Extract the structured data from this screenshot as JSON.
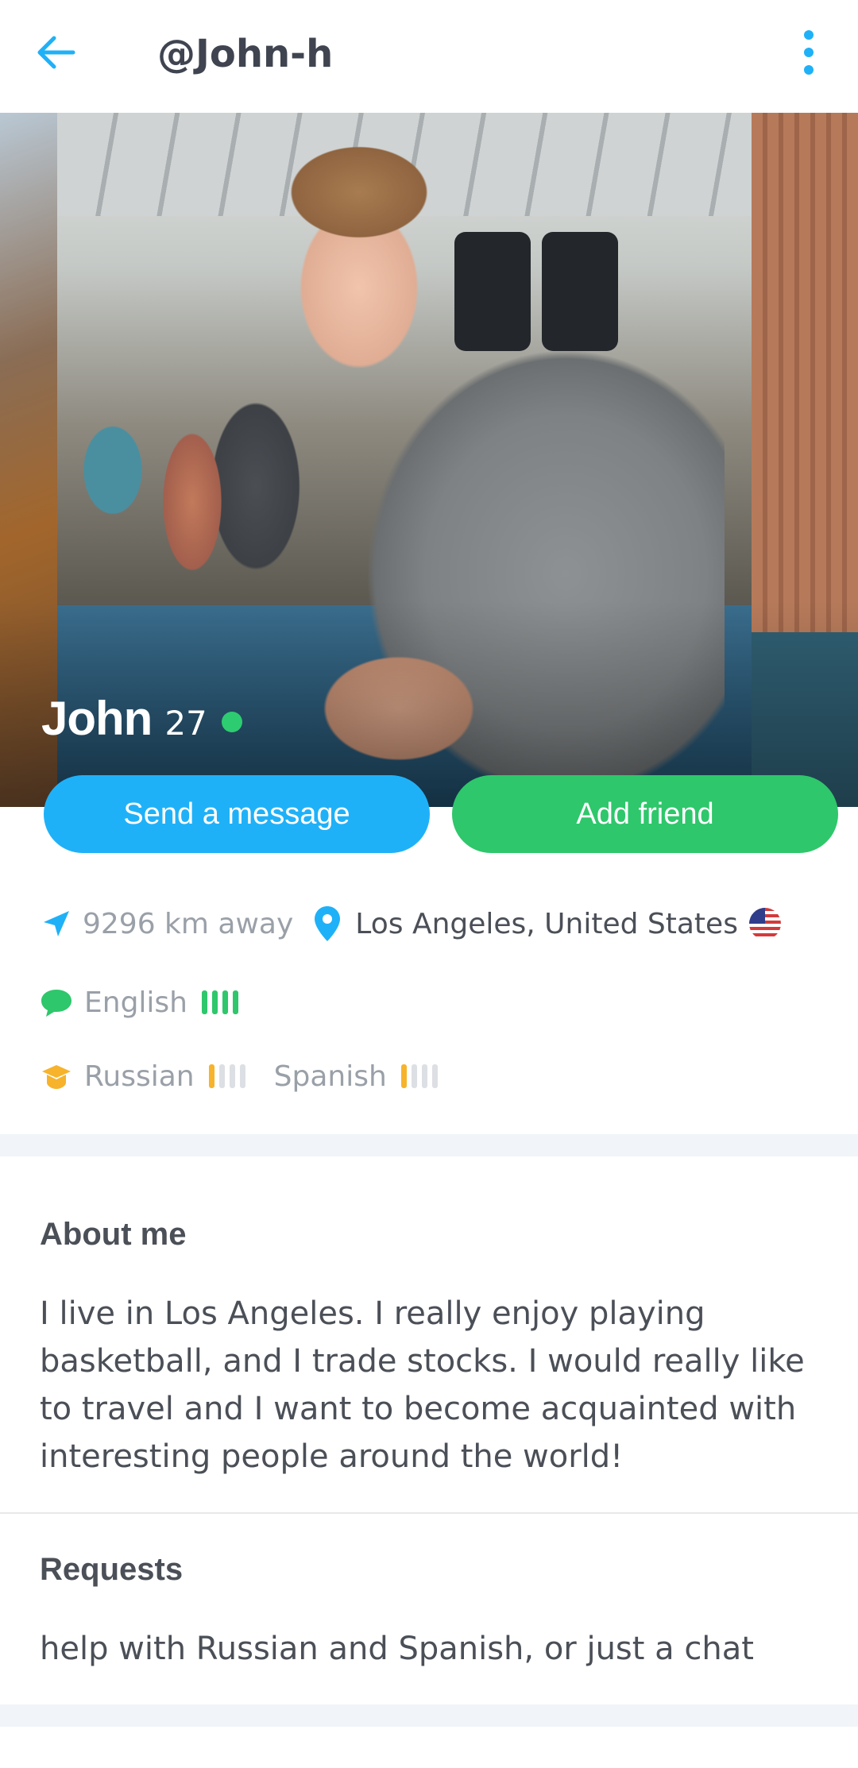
{
  "header": {
    "username": "@John-h",
    "back_icon": "arrow-left-icon",
    "menu_icon": "more-vertical-icon",
    "accent_color": "#1fb1f8"
  },
  "profile": {
    "name": "John",
    "age": "27",
    "online": true,
    "online_color": "#2ecc71"
  },
  "actions": {
    "message_label": "Send a message",
    "friend_label": "Add friend",
    "message_color": "#1fb1f8",
    "friend_color": "#2ec76b"
  },
  "location": {
    "distance": "9296 km away",
    "place": "Los Angeles, United States",
    "flag": "us-flag-icon"
  },
  "languages": {
    "native": [
      {
        "name": "English",
        "level": 4
      }
    ],
    "learning": [
      {
        "name": "Russian",
        "level": 1
      },
      {
        "name": "Spanish",
        "level": 1
      }
    ]
  },
  "about": {
    "title": "About me",
    "text": "I live in Los Angeles. I really enjoy playing basketball, and I trade stocks. I would really like to travel and I want to become acquainted with interesting people around the world!"
  },
  "requests": {
    "title": "Requests",
    "text": "help with Russian and Spanish, or just a chat"
  }
}
